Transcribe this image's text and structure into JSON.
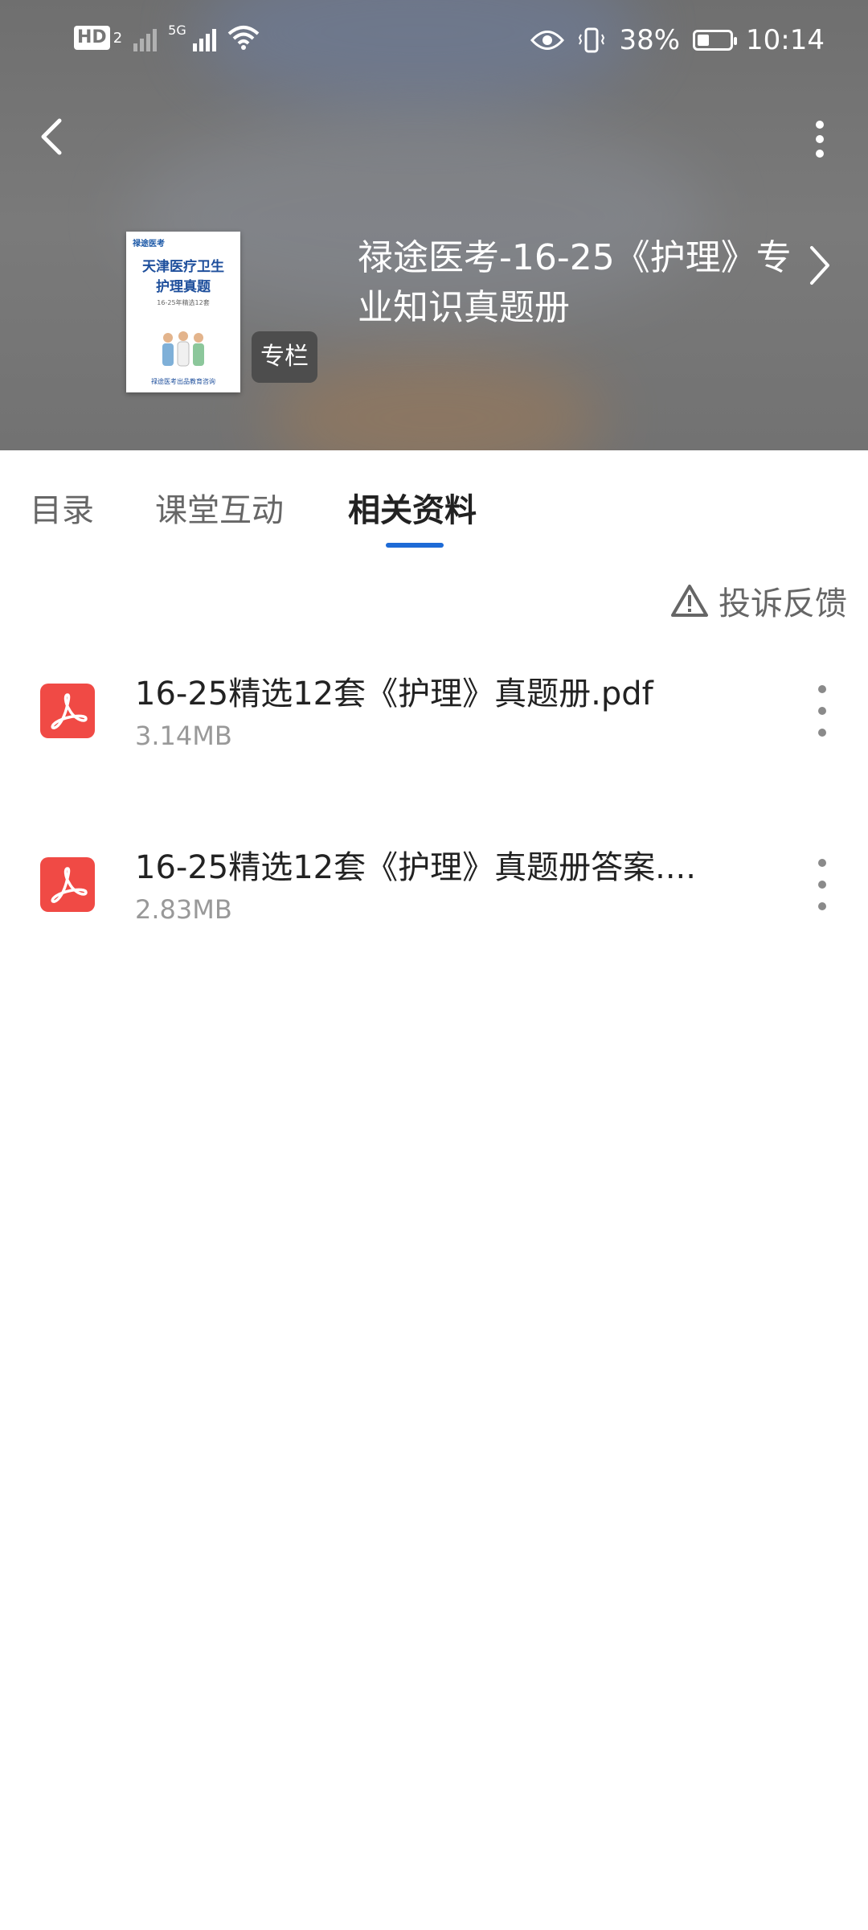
{
  "status_bar": {
    "hd_label": "HD",
    "hd_sub": "2",
    "network_label": "5G",
    "battery": "38%",
    "battery_level": 0.38,
    "time": "10:14"
  },
  "header": {
    "cover": {
      "logo": "禄途医考",
      "line1": "天津医疗卫生",
      "line2": "护理真题",
      "line3": "16-25年精选12套",
      "footer": "禄途医考出品教育咨询"
    },
    "badge": "专栏",
    "title": "禄途医考-16-25《护理》专业知识真题册"
  },
  "tabs": [
    {
      "label": "目录"
    },
    {
      "label": "课堂互动"
    },
    {
      "label": "相关资料"
    }
  ],
  "complaint": {
    "label": "投诉反馈"
  },
  "files": [
    {
      "name": "16-25精选12套《护理》真题册.pdf",
      "size": "3.14MB"
    },
    {
      "name": "16-25精选12套《护理》真题册答案....",
      "size": "2.83MB"
    }
  ],
  "colors": {
    "accent": "#1e6bd6",
    "pdf": "#f04a45"
  }
}
